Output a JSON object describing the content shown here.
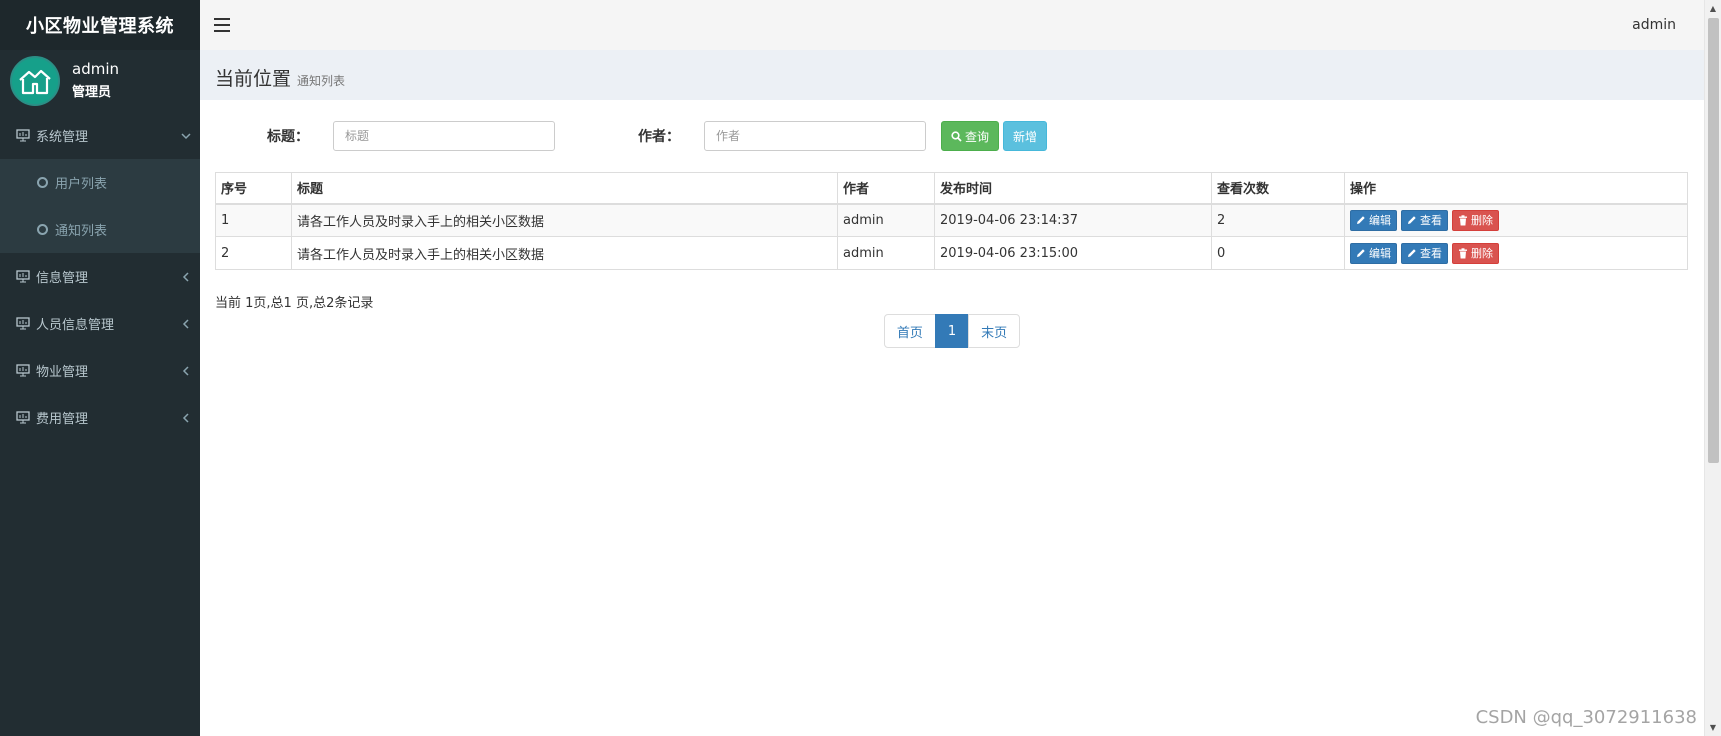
{
  "app": {
    "title": "小区物业管理系统"
  },
  "user": {
    "name": "admin",
    "role": "管理员"
  },
  "header": {
    "username": "admin"
  },
  "breadcrumb": {
    "label": "当前位置",
    "page": "通知列表"
  },
  "sidebar": {
    "items": [
      {
        "label": "系统管理",
        "icon": "monitor-icon",
        "expanded": true,
        "children": [
          {
            "label": "用户列表"
          },
          {
            "label": "通知列表"
          }
        ]
      },
      {
        "label": "信息管理",
        "icon": "monitor-icon"
      },
      {
        "label": "人员信息管理",
        "icon": "monitor-icon"
      },
      {
        "label": "物业管理",
        "icon": "monitor-icon"
      },
      {
        "label": "费用管理",
        "icon": "monitor-icon"
      }
    ]
  },
  "search": {
    "title_label": "标题：",
    "title_placeholder": "标题",
    "author_label": "作者：",
    "author_placeholder": "作者",
    "query_button": "查询",
    "add_button": "新增"
  },
  "table": {
    "columns": [
      "序号",
      "标题",
      "作者",
      "发布时间",
      "查看次数",
      "操作"
    ],
    "rows": [
      {
        "id": "1",
        "title": "请各工作人员及时录入手上的相关小区数据",
        "author": "admin",
        "time": "2019-04-06 23:14:37",
        "views": "2"
      },
      {
        "id": "2",
        "title": "请各工作人员及时录入手上的相关小区数据",
        "author": "admin",
        "time": "2019-04-06 23:15:00",
        "views": "0"
      }
    ],
    "actions": {
      "edit": "编辑",
      "view": "查看",
      "delete": "删除"
    }
  },
  "pagination": {
    "summary": "当前 1页,总1 页,总2条记录",
    "first": "首页",
    "current": "1",
    "last": "末页"
  },
  "watermark": "CSDN @qq_3072911638",
  "colors": {
    "sidebar_bg": "#222d32",
    "accent": "#337ab7",
    "success": "#5cb85c",
    "info": "#5bc0de",
    "danger": "#d9534f",
    "avatar": "#16a08a"
  }
}
